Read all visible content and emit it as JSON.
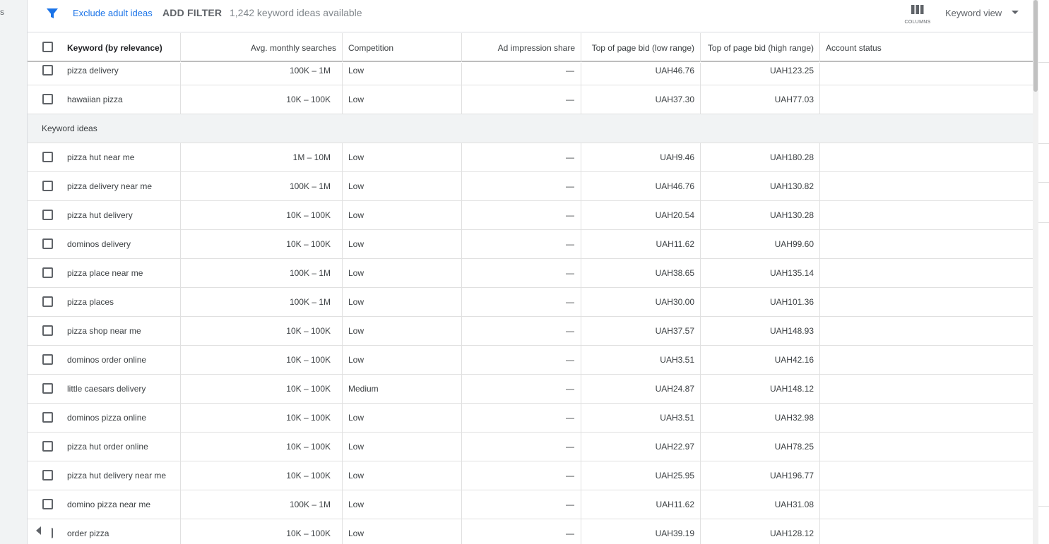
{
  "left_rail": {
    "text": "s"
  },
  "toolbar": {
    "exclude_label": "Exclude adult ideas",
    "add_filter_label": "ADD FILTER",
    "ideas_count": "1,242 keyword ideas available",
    "columns_label": "COLUMNS",
    "view_label": "Keyword view",
    "filter_icon": "filter-funnel-icon",
    "columns_icon": "columns-icon"
  },
  "columns": [
    "Keyword (by relevance)",
    "Avg. monthly searches",
    "Competition",
    "Ad impression share",
    "Top of page bid (low range)",
    "Top of page bid (high range)",
    "Account status"
  ],
  "provided_rows": [
    {
      "keyword": "pizza delivery",
      "searches": "100K – 1M",
      "competition": "Low",
      "impression": "—",
      "bid_low": "UAH46.76",
      "bid_high": "UAH123.25"
    },
    {
      "keyword": "hawaiian pizza",
      "searches": "10K – 100K",
      "competition": "Low",
      "impression": "—",
      "bid_low": "UAH37.30",
      "bid_high": "UAH77.03"
    }
  ],
  "section_label": "Keyword ideas",
  "idea_rows": [
    {
      "keyword": "pizza hut near me",
      "searches": "1M – 10M",
      "competition": "Low",
      "impression": "—",
      "bid_low": "UAH9.46",
      "bid_high": "UAH180.28"
    },
    {
      "keyword": "pizza delivery near me",
      "searches": "100K – 1M",
      "competition": "Low",
      "impression": "—",
      "bid_low": "UAH46.76",
      "bid_high": "UAH130.82"
    },
    {
      "keyword": "pizza hut delivery",
      "searches": "10K – 100K",
      "competition": "Low",
      "impression": "—",
      "bid_low": "UAH20.54",
      "bid_high": "UAH130.28"
    },
    {
      "keyword": "dominos delivery",
      "searches": "10K – 100K",
      "competition": "Low",
      "impression": "—",
      "bid_low": "UAH11.62",
      "bid_high": "UAH99.60"
    },
    {
      "keyword": "pizza place near me",
      "searches": "100K – 1M",
      "competition": "Low",
      "impression": "—",
      "bid_low": "UAH38.65",
      "bid_high": "UAH135.14"
    },
    {
      "keyword": "pizza places",
      "searches": "100K – 1M",
      "competition": "Low",
      "impression": "—",
      "bid_low": "UAH30.00",
      "bid_high": "UAH101.36"
    },
    {
      "keyword": "pizza shop near me",
      "searches": "10K – 100K",
      "competition": "Low",
      "impression": "—",
      "bid_low": "UAH37.57",
      "bid_high": "UAH148.93"
    },
    {
      "keyword": "dominos order online",
      "searches": "10K – 100K",
      "competition": "Low",
      "impression": "—",
      "bid_low": "UAH3.51",
      "bid_high": "UAH42.16"
    },
    {
      "keyword": "little caesars delivery",
      "searches": "10K – 100K",
      "competition": "Medium",
      "impression": "—",
      "bid_low": "UAH24.87",
      "bid_high": "UAH148.12"
    },
    {
      "keyword": "dominos pizza online",
      "searches": "10K – 100K",
      "competition": "Low",
      "impression": "—",
      "bid_low": "UAH3.51",
      "bid_high": "UAH32.98"
    },
    {
      "keyword": "pizza hut order online",
      "searches": "10K – 100K",
      "competition": "Low",
      "impression": "—",
      "bid_low": "UAH22.97",
      "bid_high": "UAH78.25"
    },
    {
      "keyword": "pizza hut delivery near me",
      "searches": "10K – 100K",
      "competition": "Low",
      "impression": "—",
      "bid_low": "UAH25.95",
      "bid_high": "UAH196.77"
    },
    {
      "keyword": "domino pizza near me",
      "searches": "100K – 1M",
      "competition": "Low",
      "impression": "—",
      "bid_low": "UAH11.62",
      "bid_high": "UAH31.08"
    },
    {
      "keyword": "order pizza",
      "searches": "10K – 100K",
      "competition": "Low",
      "impression": "—",
      "bid_low": "UAH39.19",
      "bid_high": "UAH128.12"
    }
  ]
}
